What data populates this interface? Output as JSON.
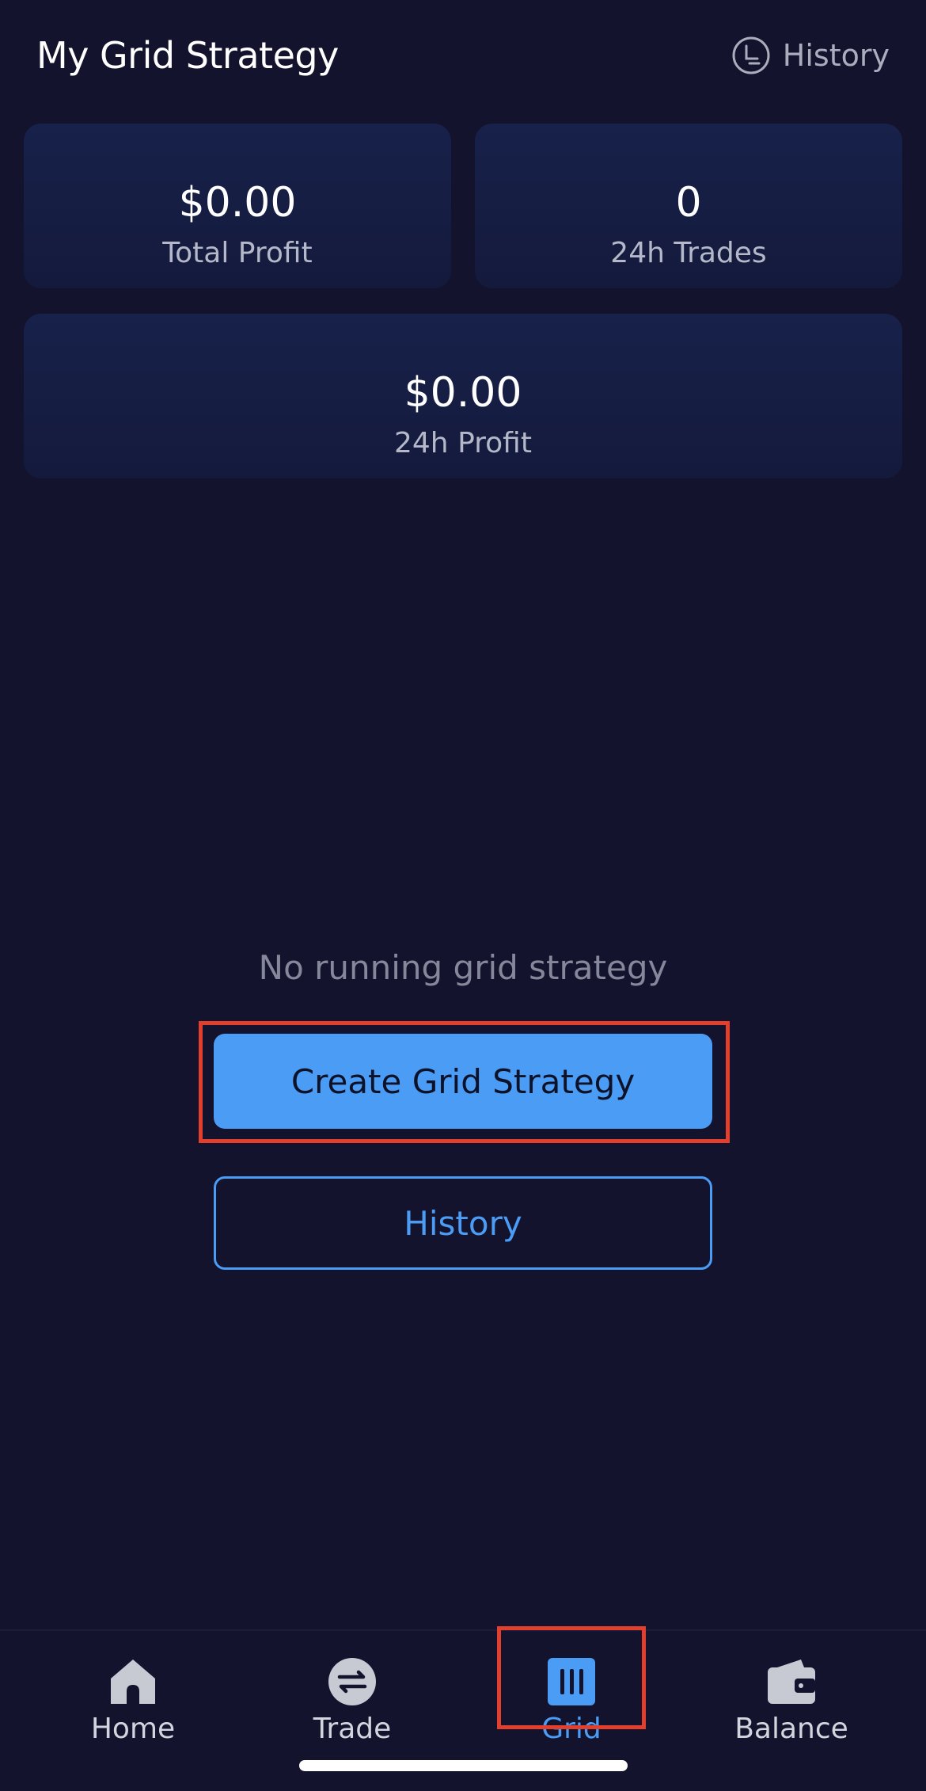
{
  "header": {
    "title": "My Grid Strategy",
    "history_label": "History"
  },
  "stats": {
    "total_profit": {
      "value": "$0.00",
      "label": "Total Profit"
    },
    "trades_24h": {
      "value": "0",
      "label": "24h Trades"
    },
    "profit_24h": {
      "value": "$0.00",
      "label": "24h Profit"
    }
  },
  "empty_state": {
    "message": "No running grid strategy",
    "create_label": "Create Grid Strategy",
    "history_label": "History"
  },
  "tabbar": {
    "items": [
      {
        "label": "Home",
        "icon": "home-icon",
        "active": false
      },
      {
        "label": "Trade",
        "icon": "swap-icon",
        "active": false
      },
      {
        "label": "Grid",
        "icon": "grid-bars-icon",
        "active": true
      },
      {
        "label": "Balance",
        "icon": "wallet-icon",
        "active": false
      }
    ]
  },
  "colors": {
    "background": "#13132d",
    "accent": "#4a9cf5",
    "highlight": "#e2402c"
  }
}
